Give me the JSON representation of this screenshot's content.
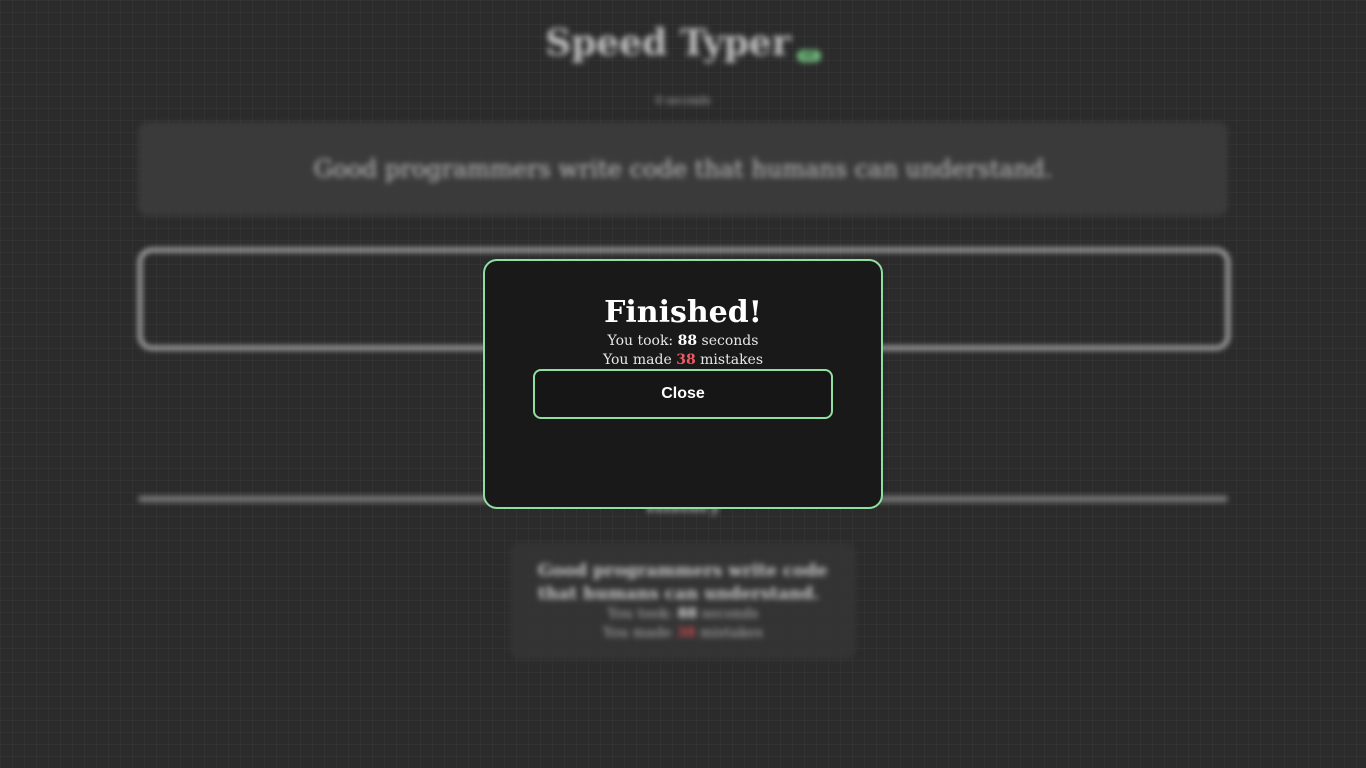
{
  "app": {
    "title": "Speed Typer",
    "badge": "v1",
    "timer": "0 seconds"
  },
  "prompt": {
    "quote": "Good programmers write code that humans can understand."
  },
  "input": {
    "value": ""
  },
  "history": {
    "heading": "History",
    "entries": [
      {
        "quote": "Good programmers write code that humans can understand.",
        "time_prefix": "You took: ",
        "time_value": "88",
        "time_suffix": " seconds",
        "mistakes_prefix": "You made ",
        "mistakes_value": "38",
        "mistakes_suffix": " mistakes"
      }
    ]
  },
  "modal": {
    "title": "Finished!",
    "time_prefix": "You took: ",
    "time_value": "88",
    "time_suffix": " seconds",
    "mistakes_prefix": "You made ",
    "mistakes_value": "38",
    "mistakes_suffix": " mistakes",
    "close_label": "Close"
  },
  "colors": {
    "accent": "#8fe0a0",
    "mistake": "#ef5a62",
    "background": "#2b2b2b",
    "modal_background": "#191919"
  }
}
